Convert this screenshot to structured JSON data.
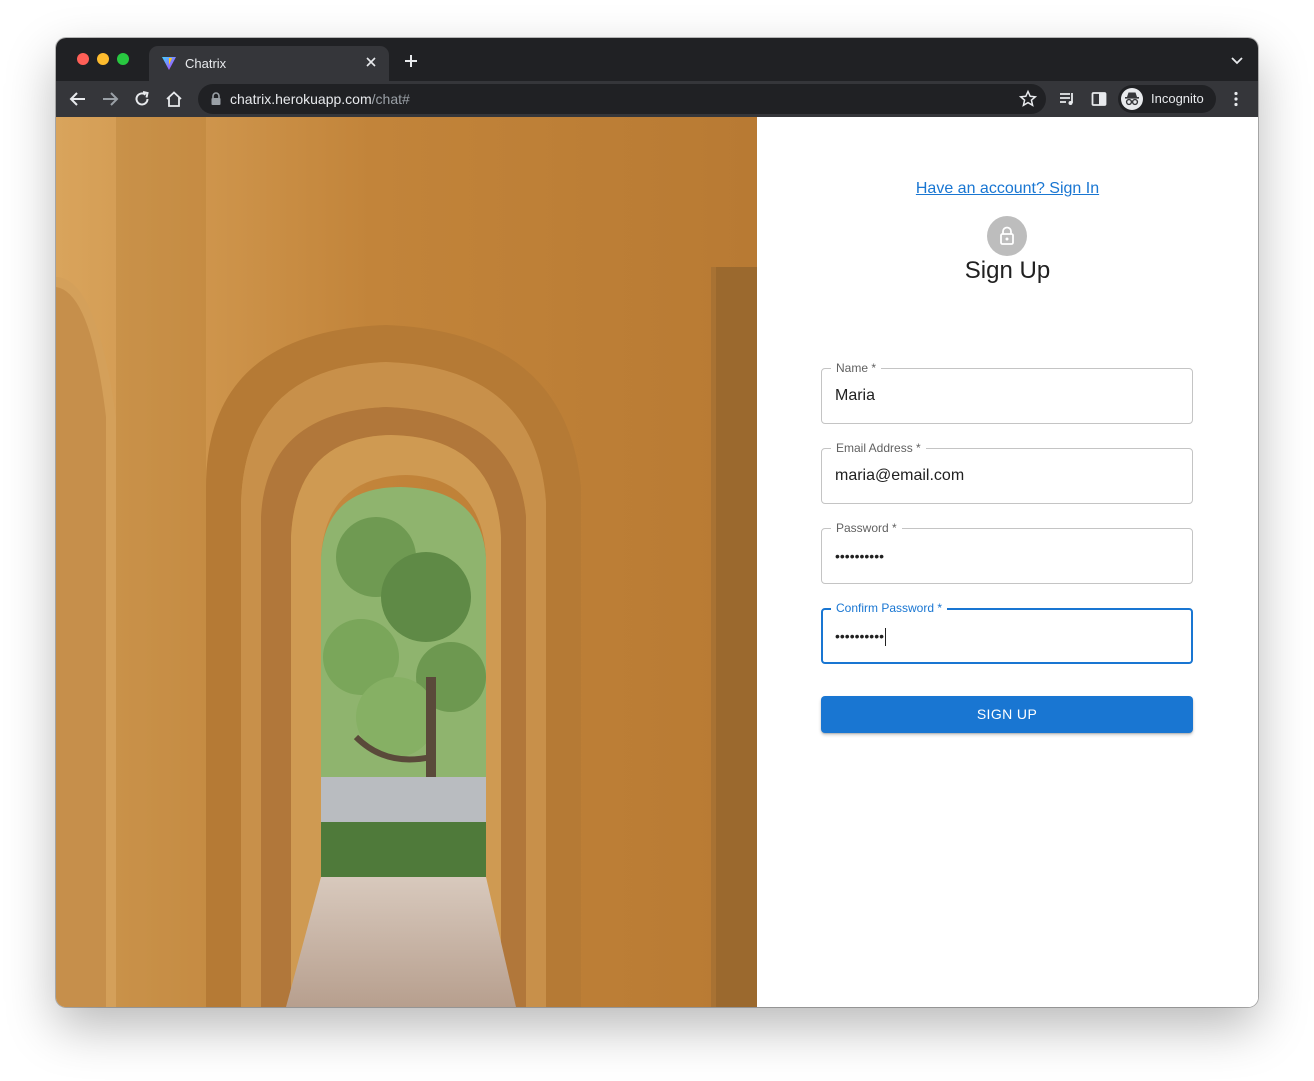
{
  "browser": {
    "tab_title": "Chatrix",
    "url_host": "chatrix.herokuapp.com",
    "url_path": "/chat#",
    "profile_label": "Incognito"
  },
  "form": {
    "signin_link": "Have an account? Sign In",
    "title": "Sign Up",
    "fields": [
      {
        "label": "Name *",
        "value": "Maria"
      },
      {
        "label": "Email Address *",
        "value": "maria@email.com"
      },
      {
        "label": "Password *",
        "value": "••••••••••"
      },
      {
        "label": "Confirm Password *",
        "value": "••••••••••"
      }
    ],
    "submit_label": "SIGN UP"
  },
  "colors": {
    "primary": "#1976d2",
    "avatar_bg": "#bdbdbd",
    "wall": "#c98a3c",
    "browser_chrome": "#35363a"
  }
}
